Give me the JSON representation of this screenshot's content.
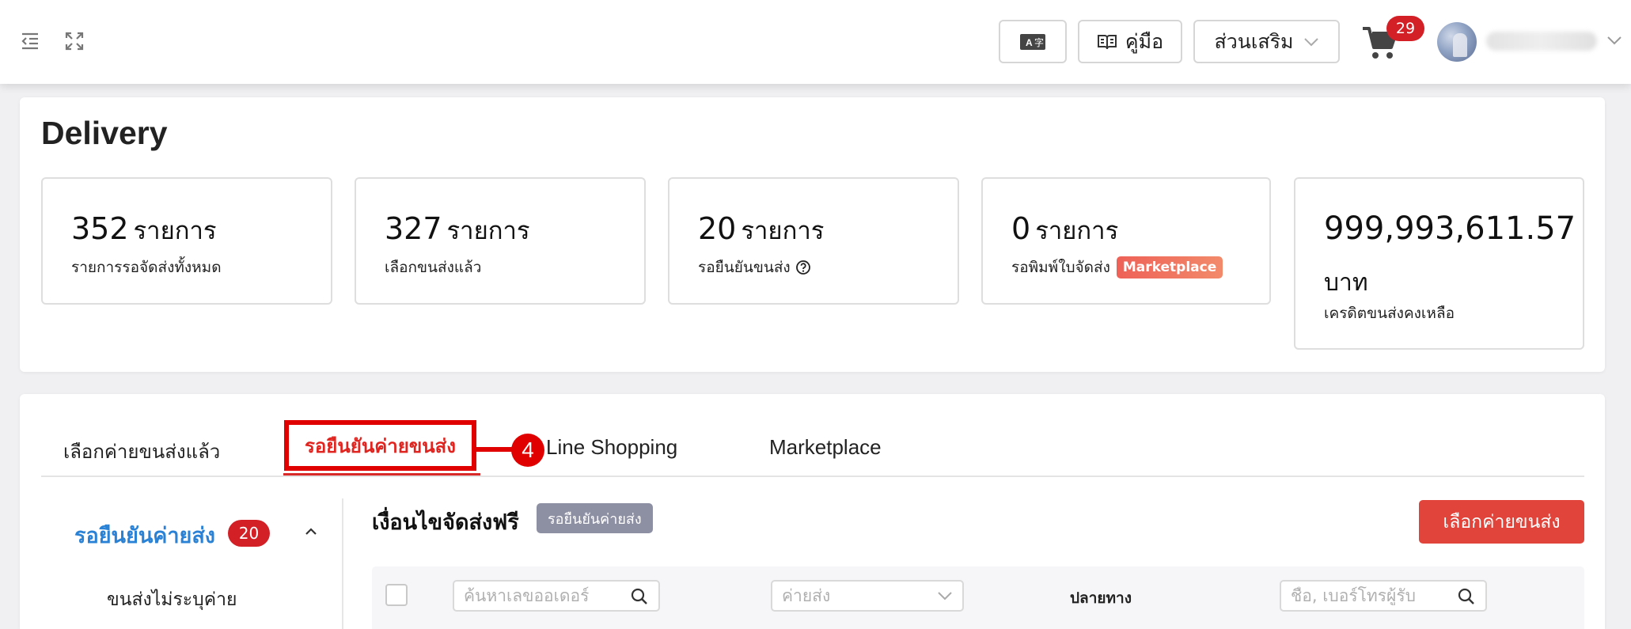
{
  "header": {
    "manual_label": "คู่มือ",
    "addons_label": "ส่วนเสริม",
    "cart_count": "29"
  },
  "page": {
    "title": "Delivery"
  },
  "stats": [
    {
      "value": "352",
      "unit": "รายการ",
      "label": "รายการรอจัดส่งทั้งหมด"
    },
    {
      "value": "327",
      "unit": "รายการ",
      "label": "เลือกขนส่งแล้ว"
    },
    {
      "value": "20",
      "unit": "รายการ",
      "label": "รอยืนยันขนส่ง"
    },
    {
      "value": "0",
      "unit": "รายการ",
      "label": "รอพิมพ์ใบจัดส่ง",
      "badge": "Marketplace"
    },
    {
      "value": "999,993,611.57",
      "unit": "บาท",
      "label": "เครดิตขนส่งคงเหลือ"
    }
  ],
  "tabs": [
    {
      "label": "เลือกค่ายขนส่งแล้ว"
    },
    {
      "label": "รอยืนยันค่ายขนส่ง"
    },
    {
      "label": "Line Shopping"
    },
    {
      "label": "Marketplace"
    }
  ],
  "callout": {
    "number": "4",
    "color": "#e10000"
  },
  "sidebar": {
    "active_label": "รอยืนยันค่ายส่ง",
    "active_count": "20",
    "sub_item": "ขนส่งไม่ระบุค่าย"
  },
  "main": {
    "section_title": "เงื่อนไขจัดส่งฟรี",
    "status_chip": "รอยืนยันค่ายส่ง",
    "choose_button": "เลือกค่ายขนส่ง",
    "order_search_placeholder": "ค้นหาเลขออเดอร์",
    "carrier_placeholder": "ค่ายส่ง",
    "destination_header": "ปลายทาง",
    "recipient_search_placeholder": "ชื่อ, เบอร์โทรผู้รับ"
  },
  "colors": {
    "accent_red": "#e0443a",
    "active_blue": "#2a82d6",
    "badge_red": "#d32027"
  }
}
